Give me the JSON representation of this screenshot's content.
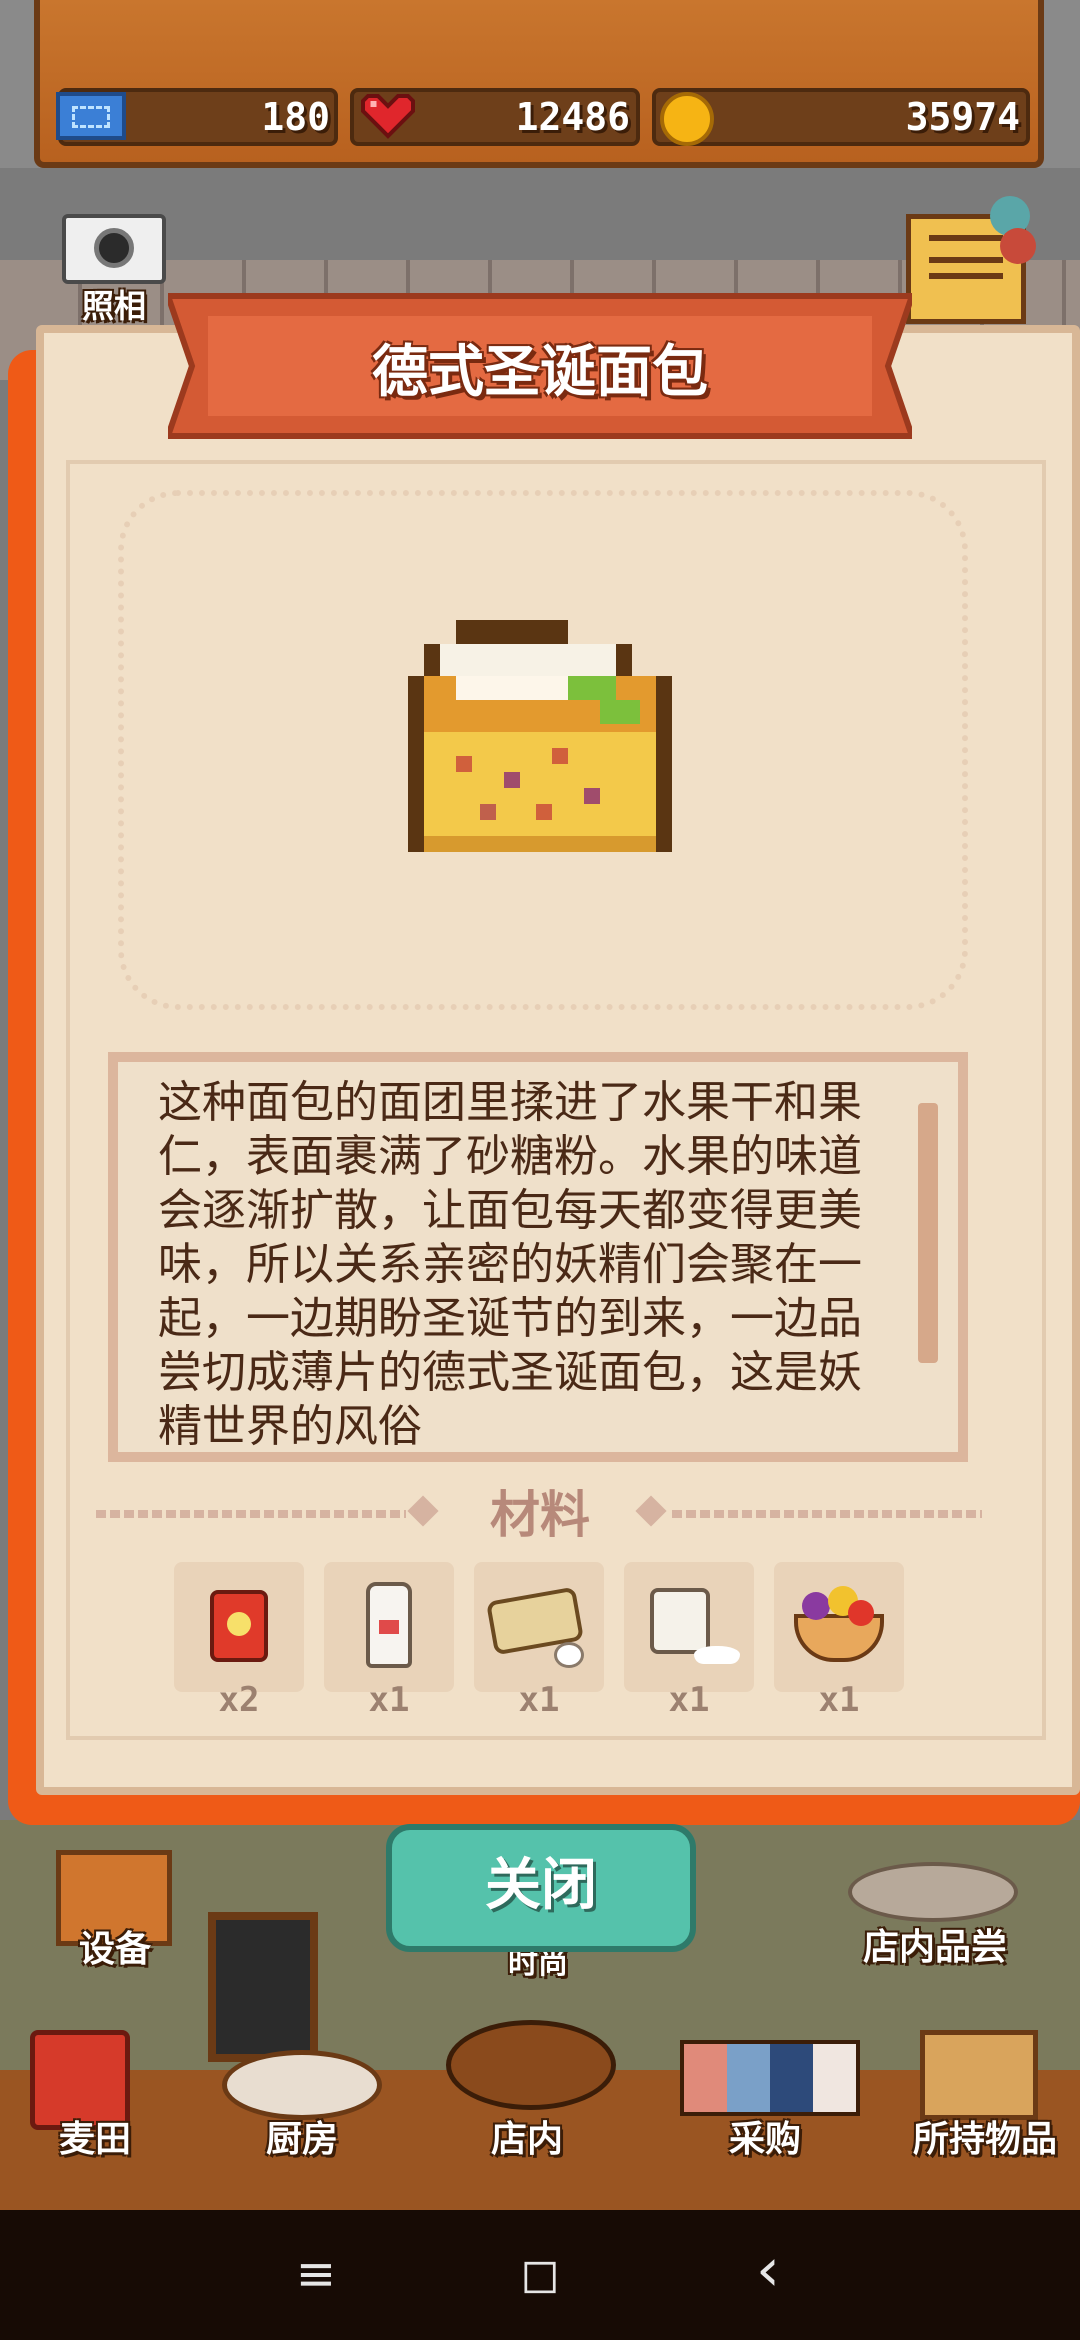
{
  "stats": {
    "tickets": "180",
    "hearts": "12486",
    "coins": "35974"
  },
  "camera_label": "照相",
  "recipe": {
    "title": "德式圣诞面包",
    "description": "这种面包的面团里揉进了水果干和果仁，表面裹满了砂糖粉。水果的味道会逐渐扩散，让面包每天都变得更美味，所以关系亲密的妖精们会聚在一起，一边期盼圣诞节的到来，一边品尝切成薄片的德式圣诞面包，这是妖精世界的风俗"
  },
  "materials": {
    "label": "材料",
    "items": [
      {
        "icon": "flour-bag-icon",
        "qty": "x2"
      },
      {
        "icon": "milk-bottle-icon",
        "qty": "x1"
      },
      {
        "icon": "butter-eggs-icon",
        "qty": "x1"
      },
      {
        "icon": "sugar-jar-icon",
        "qty": "x1"
      },
      {
        "icon": "fruit-basket-icon",
        "qty": "x1"
      }
    ]
  },
  "close_label": "关闭",
  "scene": {
    "equipment": "设备",
    "tasting": "店内品尝",
    "partial_label": "时尚"
  },
  "nav": {
    "wheat_field": "麦田",
    "kitchen": "厨房",
    "store": "店内",
    "purchase": "采购",
    "inventory": "所持物品"
  },
  "system": {
    "menu": "≡",
    "home": "◻",
    "back": "‹"
  }
}
